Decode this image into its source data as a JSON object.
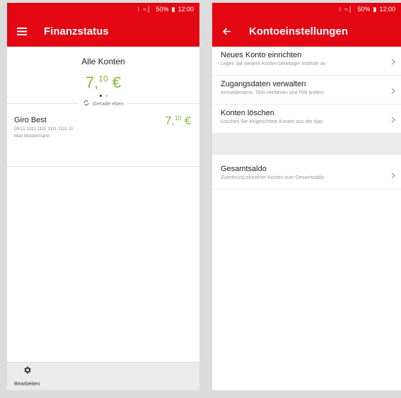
{
  "statusbar": {
    "signal": "≈.▏",
    "battery": "50%",
    "battery_icon": "▮",
    "time": "12:00"
  },
  "left": {
    "title": "Finanzstatus",
    "overview": {
      "label": "Alle Konten",
      "amount_main": "7,",
      "amount_cents": "10",
      "currency": " €"
    },
    "refresh_text": "Gerade eben",
    "account": {
      "name": "Giro Best",
      "iban": "DE11 1111 1111 1111 1111 11",
      "owner": "Max Mustermann",
      "amount_main": "7,",
      "amount_cents": "10",
      "currency": " €"
    },
    "bottom": {
      "edit_label": "Bearbeiten"
    }
  },
  "right": {
    "title": "Kontoeinstellungen",
    "items": [
      {
        "title": "Neues Konto einrichten",
        "subtitle": "Legen Sie weitere Konten beliebiger Institute an"
      },
      {
        "title": "Zugangsdaten verwalten",
        "subtitle": "Anmeldename, TAN-Verfahren und PIN ändern"
      },
      {
        "title": "Konten löschen",
        "subtitle": "Löschen Sie eingerichtete Konten aus der App"
      }
    ],
    "total_item": {
      "title": "Gesamtsaldo",
      "subtitle": "Zuordnung einzelner Konten zum Gesamtsaldo"
    }
  },
  "colors": {
    "brand_red": "#e30613",
    "amount_green": "#8cb43c"
  },
  "icons": [
    "menu-icon",
    "back-arrow-icon",
    "refresh-icon",
    "gear-icon",
    "chevron-right-icon",
    "wifi-icon",
    "battery-icon"
  ]
}
